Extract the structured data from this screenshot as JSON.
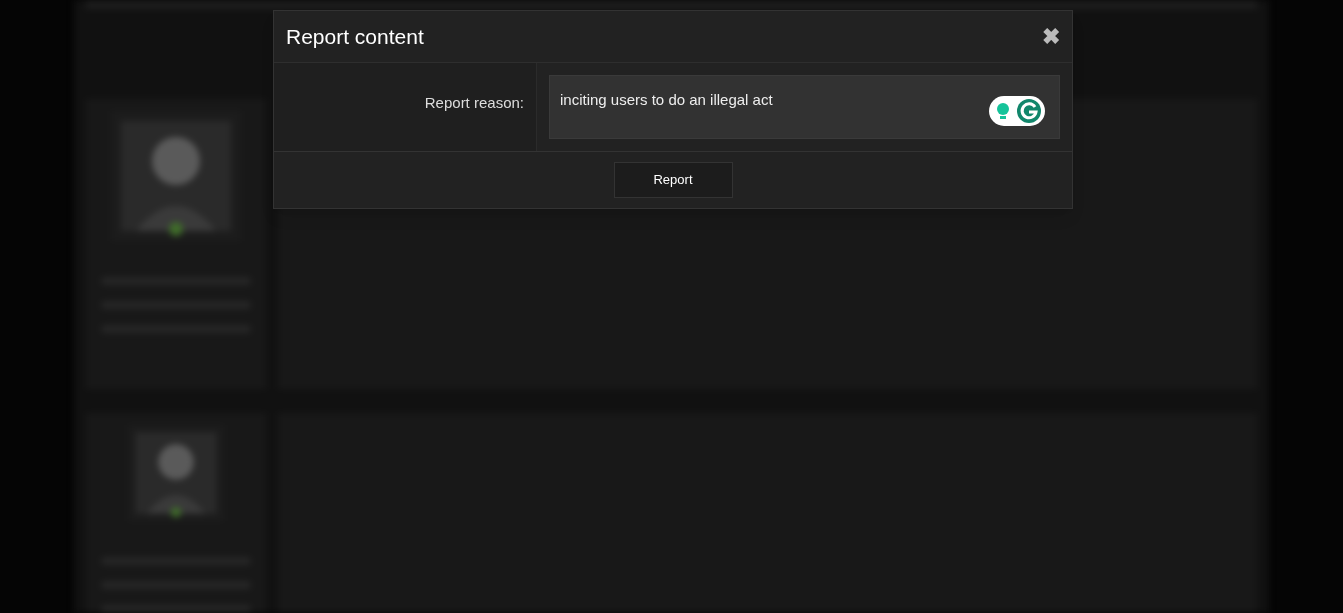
{
  "dialog": {
    "title": "Report content",
    "close": "✖",
    "field_label": "Report reason:",
    "field_value": "inciting users to do an illegal act",
    "button": "Report"
  }
}
